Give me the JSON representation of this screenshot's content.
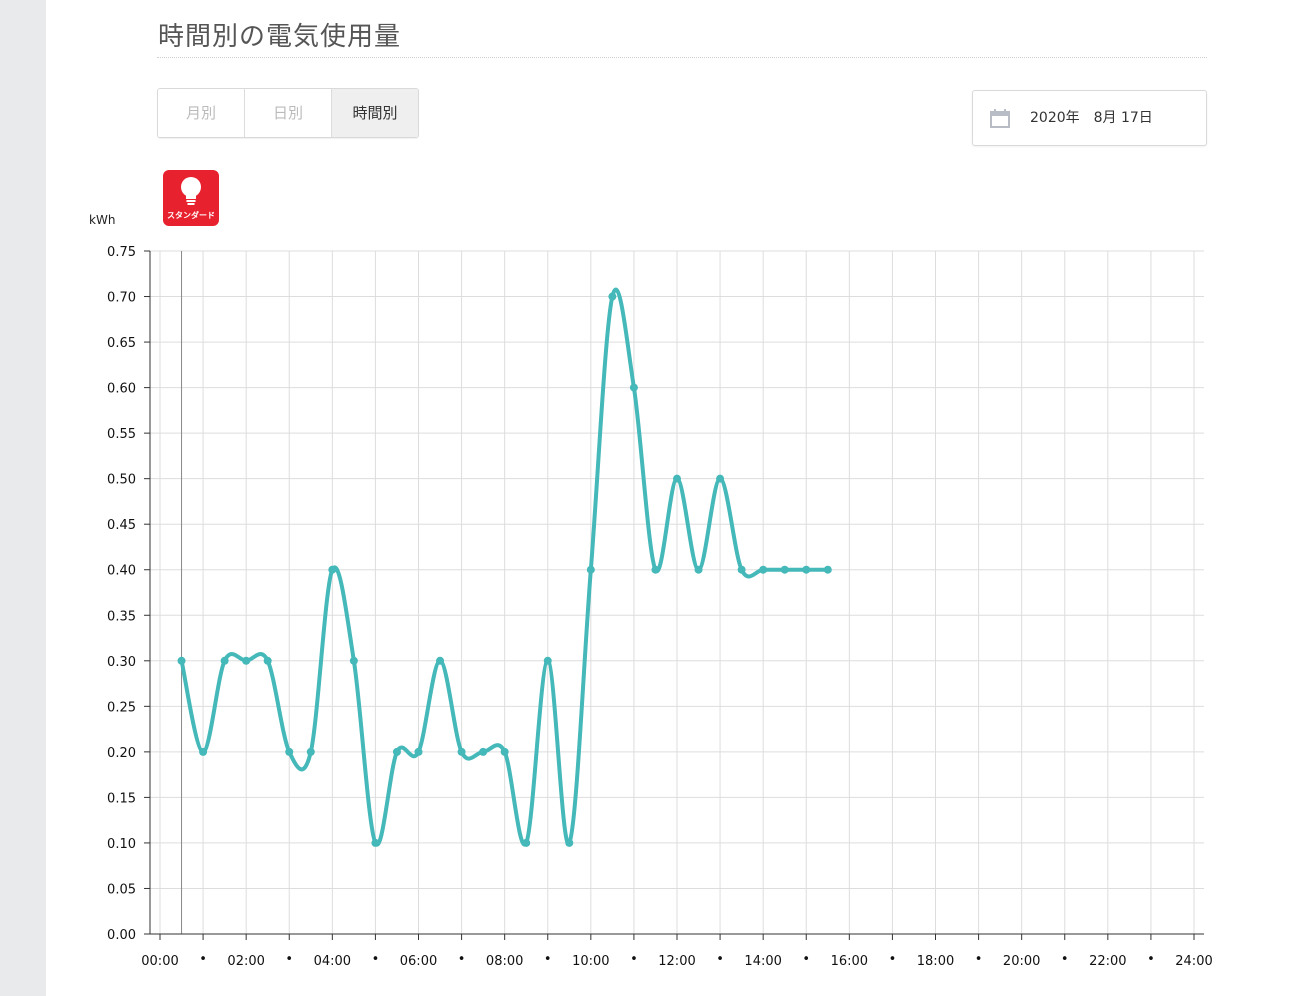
{
  "header": {
    "title": "時間別の電気使用量"
  },
  "tabs": [
    {
      "label": "月別",
      "active": false
    },
    {
      "label": "日別",
      "active": false
    },
    {
      "label": "時間別",
      "active": true
    }
  ],
  "date_picker": {
    "icon": "calendar-icon",
    "value": "2020年　8月 17日"
  },
  "plan_badge": {
    "icon": "lightbulb-icon",
    "label": "スタンダード",
    "color": "#e8212e"
  },
  "colors": {
    "line": "#45b8b9",
    "grid": "#dddddd"
  },
  "chart_data": {
    "type": "line",
    "ylabel": "kWh",
    "ylim": [
      0,
      0.75
    ],
    "yticks": [
      "0.00",
      "0.05",
      "0.10",
      "0.15",
      "0.20",
      "0.25",
      "0.30",
      "0.35",
      "0.40",
      "0.45",
      "0.50",
      "0.55",
      "0.60",
      "0.65",
      "0.70",
      "0.75"
    ],
    "xlim": [
      "00:00",
      "24:00"
    ],
    "xtick_labels": [
      "00:00",
      "•",
      "02:00",
      "•",
      "04:00",
      "•",
      "06:00",
      "•",
      "08:00",
      "•",
      "10:00",
      "•",
      "12:00",
      "•",
      "14:00",
      "•",
      "16:00",
      "•",
      "18:00",
      "•",
      "20:00",
      "•",
      "22:00",
      "•",
      "24:00"
    ],
    "grid": true,
    "series": [
      {
        "x": [
          "00:30",
          "01:00",
          "01:30",
          "02:00",
          "02:30",
          "03:00",
          "03:30",
          "04:00",
          "04:30",
          "05:00",
          "05:30",
          "06:00",
          "06:30",
          "07:00",
          "07:30",
          "08:00",
          "08:30",
          "09:00",
          "09:30",
          "10:00",
          "10:30",
          "11:00",
          "11:30",
          "12:00",
          "12:30",
          "13:00",
          "13:30",
          "14:00",
          "14:30",
          "15:00",
          "15:30"
        ],
        "values": [
          0.3,
          0.2,
          0.3,
          0.3,
          0.3,
          0.2,
          0.2,
          0.4,
          0.3,
          0.1,
          0.2,
          0.2,
          0.3,
          0.2,
          0.2,
          0.2,
          0.1,
          0.3,
          0.1,
          0.4,
          0.7,
          0.6,
          0.4,
          0.5,
          0.4,
          0.5,
          0.4,
          0.4,
          0.4,
          0.4,
          0.4
        ]
      }
    ]
  }
}
